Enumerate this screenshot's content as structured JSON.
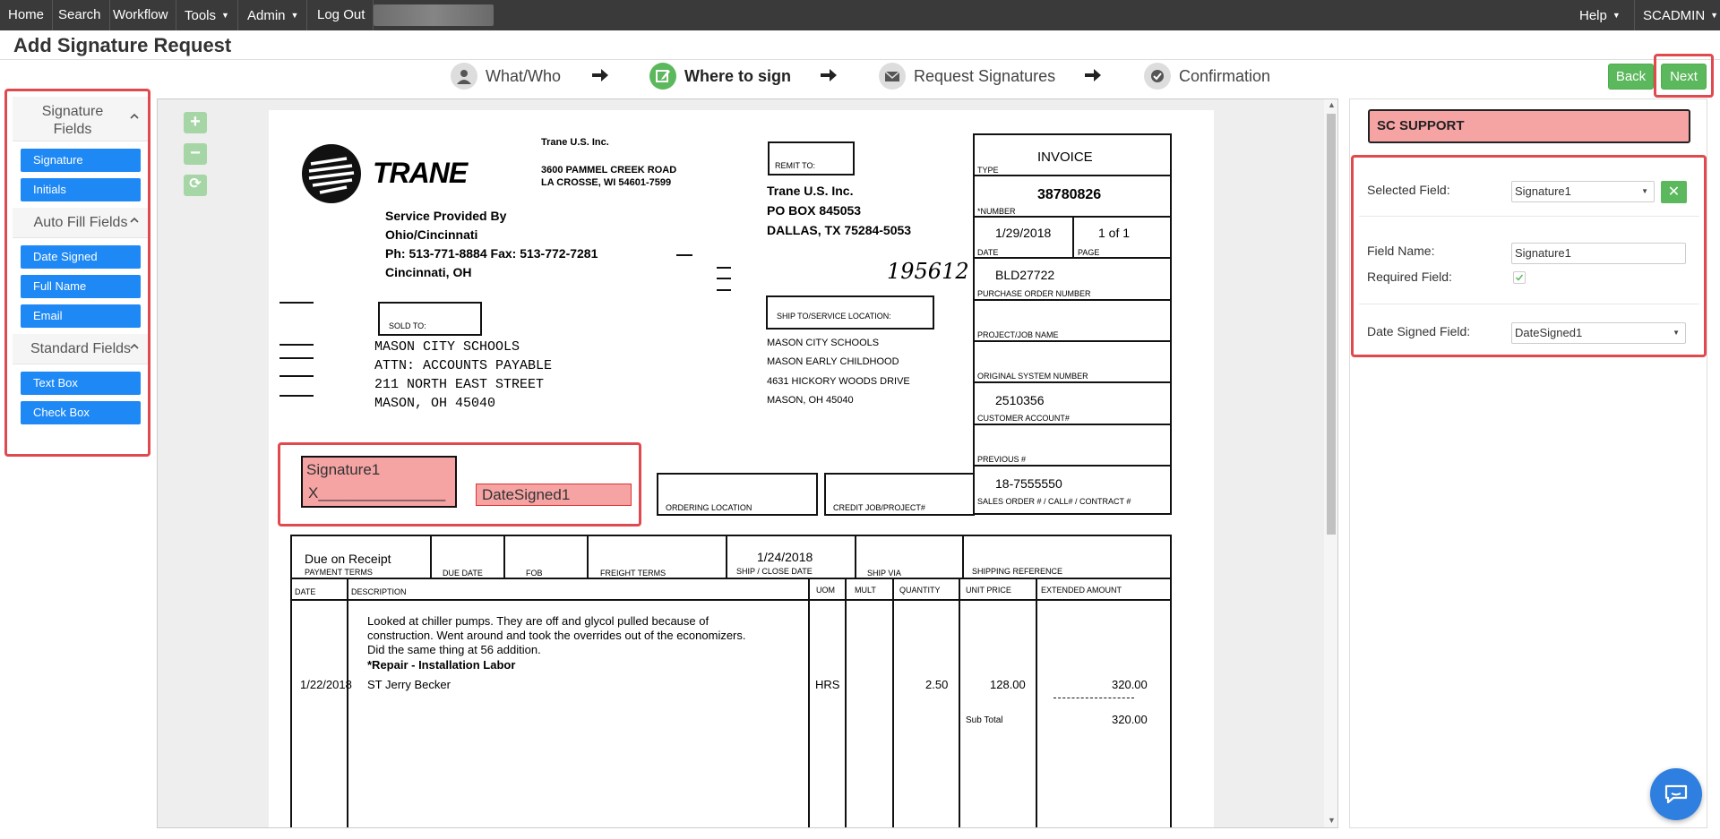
{
  "nav": {
    "home": "Home",
    "search": "Search",
    "workflow": "Workflow",
    "tools": "Tools",
    "admin": "Admin",
    "logout": "Log Out",
    "help": "Help",
    "user": "SCADMIN"
  },
  "page_title": "Add Signature Request",
  "wizard": {
    "steps": [
      {
        "label": "What/Who",
        "icon": "user-icon"
      },
      {
        "label": "Where to sign",
        "icon": "edit-icon",
        "active": true
      },
      {
        "label": "Request Signatures",
        "icon": "envelope-icon"
      },
      {
        "label": "Confirmation",
        "icon": "check-circle-icon"
      }
    ],
    "back": "Back",
    "next": "Next"
  },
  "left_panel": {
    "signature_fields": {
      "title": "Signature Fields",
      "items": [
        "Signature",
        "Initials"
      ]
    },
    "auto_fill": {
      "title": "Auto Fill Fields",
      "items": [
        "Date Signed",
        "Full Name",
        "Email"
      ]
    },
    "standard": {
      "title": "Standard Fields",
      "items": [
        "Text Box",
        "Check Box"
      ]
    }
  },
  "zoom": {
    "in": "+",
    "out": "−",
    "reset": "⟳"
  },
  "document": {
    "company": {
      "logo": "TRANE",
      "name": "Trane U.S. Inc.",
      "addr1": "3600 PAMMEL CREEK ROAD",
      "addr2": "LA CROSSE, WI  54601-7599"
    },
    "service": {
      "l1": "Service Provided By",
      "l2": "Ohio/Cincinnati",
      "l3": "Ph: 513-771-8884  Fax: 513-772-7281",
      "l4": "Cincinnati, OH"
    },
    "remit": {
      "label": "REMIT TO:",
      "l1": "Trane U.S. Inc.",
      "l2": "PO BOX 845053",
      "l3": "DALLAS, TX  75284-5053"
    },
    "handwritten": "195612",
    "sold_to_label": "SOLD TO:",
    "sold_to": [
      "MASON CITY SCHOOLS",
      "ATTN: ACCOUNTS PAYABLE",
      "211 NORTH EAST STREET",
      "MASON, OH  45040"
    ],
    "ship_to_label": "SHIP TO/SERVICE LOCATION:",
    "ship_to": [
      "MASON CITY SCHOOLS",
      "MASON EARLY CHILDHOOD",
      "4631 HICKORY WOODS DRIVE",
      "MASON, OH  45040"
    ],
    "invoice": {
      "type_label": "TYPE",
      "type": "INVOICE",
      "number_label": "*NUMBER",
      "number": "38780826",
      "date_label": "DATE",
      "date": "1/29/2018",
      "page_label": "PAGE",
      "page": "1 of 1",
      "po_label": "PURCHASE ORDER NUMBER",
      "po": "BLD27722",
      "project_label": "PROJECT/JOB NAME",
      "orig_label": "ORIGINAL SYSTEM NUMBER",
      "cust_label": "CUSTOMER ACCOUNT#",
      "cust": "2510356",
      "prev_label": "PREVIOUS #",
      "sales_label": "SALES ORDER # / CALL# / CONTRACT #",
      "sales": "18-7555550"
    },
    "ordering_label": "ORDERING LOCATION",
    "credit_label": "CREDIT JOB/PROJECT#",
    "terms": {
      "payment": "Due on Receipt",
      "payment_label": "PAYMENT TERMS",
      "due_label": "DUE DATE",
      "fob_label": "FOB",
      "freight_label": "FREIGHT TERMS",
      "ship_date": "1/24/2018",
      "ship_date_label": "SHIP / CLOSE DATE",
      "ship_via_label": "SHIP VIA",
      "ship_ref_label": "SHIPPING REFERENCE"
    },
    "columns": [
      "DATE",
      "DESCRIPTION",
      "UOM",
      "MULT",
      "QUANTITY",
      "UNIT PRICE",
      "EXTENDED AMOUNT"
    ],
    "line": {
      "desc1": "Looked at chiller pumps. They are off and glycol pulled because of",
      "desc2": "construction. Went around and took the overrides out of the economizers.",
      "desc3": "Did the same thing at 56 addition.",
      "desc4": "*Repair - Installation Labor",
      "date": "1/22/2018",
      "tech": "ST    Jerry Becker",
      "uom": "HRS",
      "qty": "2.50",
      "price": "128.00",
      "amount": "320.00",
      "subtotal_label": "Sub Total",
      "subtotal": "320.00"
    },
    "fields": {
      "signature": "Signature1",
      "signature_line": "X_______________",
      "date": "DateSigned1"
    }
  },
  "right_panel": {
    "signer": "SC SUPPORT",
    "selected_field_label": "Selected Field:",
    "selected_field": "Signature1",
    "field_name_label": "Field Name:",
    "field_name": "Signature1",
    "required_label": "Required Field:",
    "required": true,
    "date_signed_label": "Date Signed Field:",
    "date_signed": "DateSigned1"
  },
  "colors": {
    "nav_bg": "#3a3a3a",
    "accent_green": "#5cb85c",
    "field_blue": "#1e88f5",
    "highlight_red": "#e04a4f",
    "field_pink": "#f5a3a3"
  }
}
